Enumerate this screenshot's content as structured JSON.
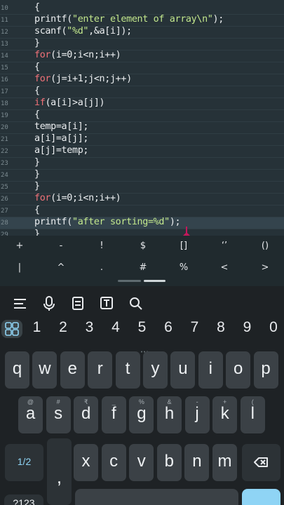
{
  "editor": {
    "lines": [
      {
        "num": "10",
        "code": "{"
      },
      {
        "num": "11",
        "code": "printf(\"enter element of array\\n\");"
      },
      {
        "num": "12",
        "code": "scanf(\"%d\",&a[i]);"
      },
      {
        "num": "13",
        "code": "}"
      },
      {
        "num": "14",
        "code": "for(i=0;i<n;i++)"
      },
      {
        "num": "15",
        "code": "{"
      },
      {
        "num": "16",
        "code": "for(j=i+1;j<n;j++)"
      },
      {
        "num": "17",
        "code": "{"
      },
      {
        "num": "18",
        "code": "if(a[i]>a[j])"
      },
      {
        "num": "19",
        "code": "{"
      },
      {
        "num": "20",
        "code": "temp=a[i];"
      },
      {
        "num": "21",
        "code": "a[i]=a[j];"
      },
      {
        "num": "22",
        "code": "a[j]=temp;"
      },
      {
        "num": "23",
        "code": "}"
      },
      {
        "num": "24",
        "code": "}"
      },
      {
        "num": "25",
        "code": "}"
      },
      {
        "num": "26",
        "code": "for(i=0;i<n;i++)"
      },
      {
        "num": "27",
        "code": "{"
      },
      {
        "num": "28",
        "code": "printf(\"after sorting=%d\");"
      },
      {
        "num": "29",
        "code": "}"
      }
    ],
    "active_line": "28"
  },
  "extra_keys": {
    "row1": [
      "+",
      "-",
      "!",
      "$",
      "[]",
      "‘’",
      "()"
    ],
    "row2": [
      "|",
      "^",
      ".",
      "#",
      "%",
      "<",
      ">"
    ]
  },
  "keyboard": {
    "toolbar": [
      "menu-icon",
      "mic-icon",
      "clipboard-icon",
      "text-edit-icon",
      "search-icon"
    ],
    "numbers": [
      "1",
      "2",
      "3",
      "4",
      "5",
      "6",
      "7",
      "8",
      "9",
      "0"
    ],
    "row_q": [
      "q",
      "w",
      "e",
      "r",
      "t",
      "y",
      "u",
      "i",
      "o",
      "p"
    ],
    "row_a": [
      {
        "k": "a",
        "h": "@"
      },
      {
        "k": "s",
        "h": "#"
      },
      {
        "k": "d",
        "h": "₹"
      },
      {
        "k": "f",
        "h": "_"
      },
      {
        "k": "g",
        "h": "%"
      },
      {
        "k": "h",
        "h": "&"
      },
      {
        "k": "j",
        "h": "-"
      },
      {
        "k": "k",
        "h": "+"
      },
      {
        "k": "l",
        "h": "("
      }
    ],
    "row_z": [
      "x",
      "c",
      "v",
      "b",
      "n",
      "m"
    ],
    "shift_label": "1/2",
    "comma_label": ",",
    "sym_label": "?123",
    "colors": {
      "accent": "#8fd4f5",
      "cursor_handle": "#c2185b",
      "keyword": "#f07178",
      "string": "#c3e88d"
    }
  }
}
